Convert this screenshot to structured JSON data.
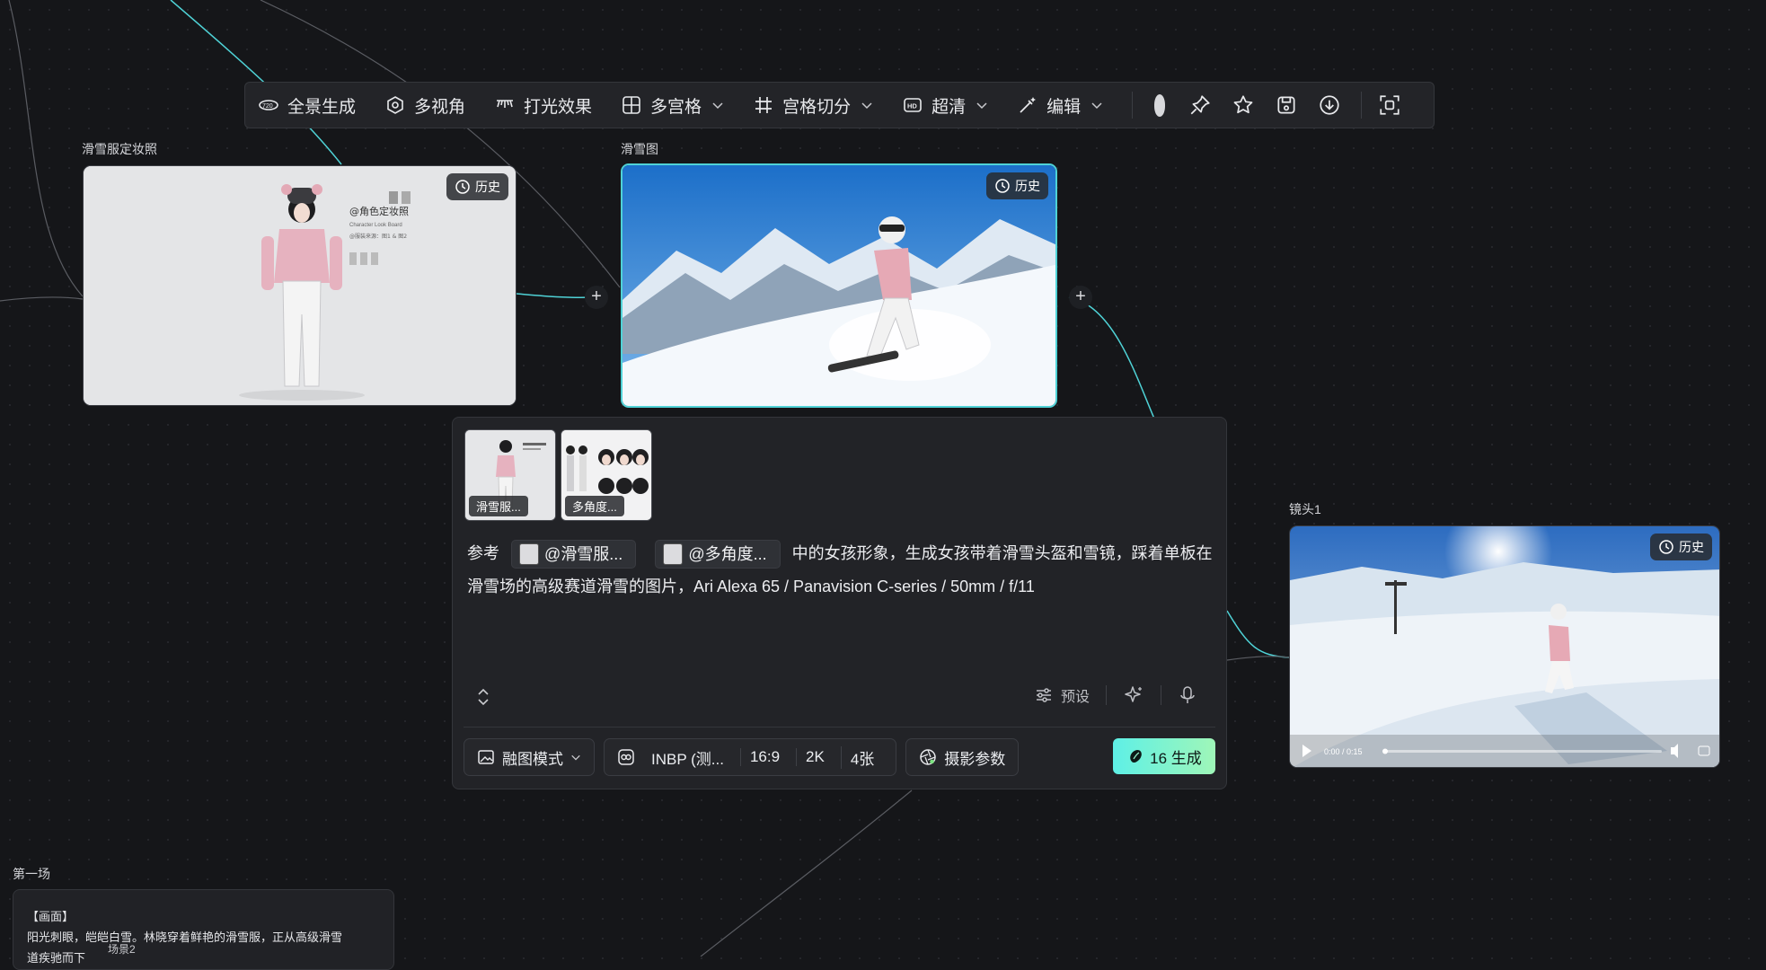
{
  "toolbar": {
    "items": [
      {
        "label": "全景生成",
        "icon": "panorama-720-icon"
      },
      {
        "label": "多视角",
        "icon": "multi-view-icon"
      },
      {
        "label": "打光效果",
        "icon": "lighting-icon"
      },
      {
        "label": "多宫格",
        "icon": "grid-icon"
      },
      {
        "label": "宫格切分",
        "icon": "hash-icon"
      },
      {
        "label": "超清",
        "icon": "hd-icon"
      },
      {
        "label": "编辑",
        "icon": "edit-wand-icon"
      }
    ],
    "icons": [
      "color-dot",
      "pin-icon",
      "star-icon",
      "save-icon",
      "download-icon",
      "fullscreen-icon"
    ],
    "color_dot": "#d8d9dc"
  },
  "nodes": {
    "outfit": {
      "title": "滑雪服定妆照",
      "history": "历史"
    },
    "ski": {
      "title": "滑雪图",
      "history": "历史"
    },
    "shot": {
      "title": "镜头1",
      "history": "历史",
      "time": "0:00 / 0:15"
    }
  },
  "panel": {
    "thumbs": [
      {
        "label": "滑雪服..."
      },
      {
        "label": "多角度..."
      }
    ],
    "prompt_prefix": "参考",
    "chip1": "@滑雪服...",
    "chip2": "@多角度...",
    "prompt_rest": "中的女孩形象，生成女孩带着滑雪头盔和雪镜，踩着单板在滑雪场的高级赛道滑雪的图片，Ari Alexa 65 / Panavision C-series / 50mm / f/11",
    "preset": "预设",
    "mode": "融图模式",
    "model": "INBP (测...",
    "ratio": "16:9",
    "resolution": "2K",
    "count": "4张",
    "camera": "摄影参数",
    "generate": "16 生成",
    "accent": "#5ef0e6"
  },
  "scene": {
    "title": "第一场",
    "heading": "【画面】",
    "line1": "阳光刺眼，皑皑白雪。林晓穿着鲜艳的滑雪服，正从高级滑雪",
    "line2": "道疾驰而下",
    "tag": "场景2"
  }
}
